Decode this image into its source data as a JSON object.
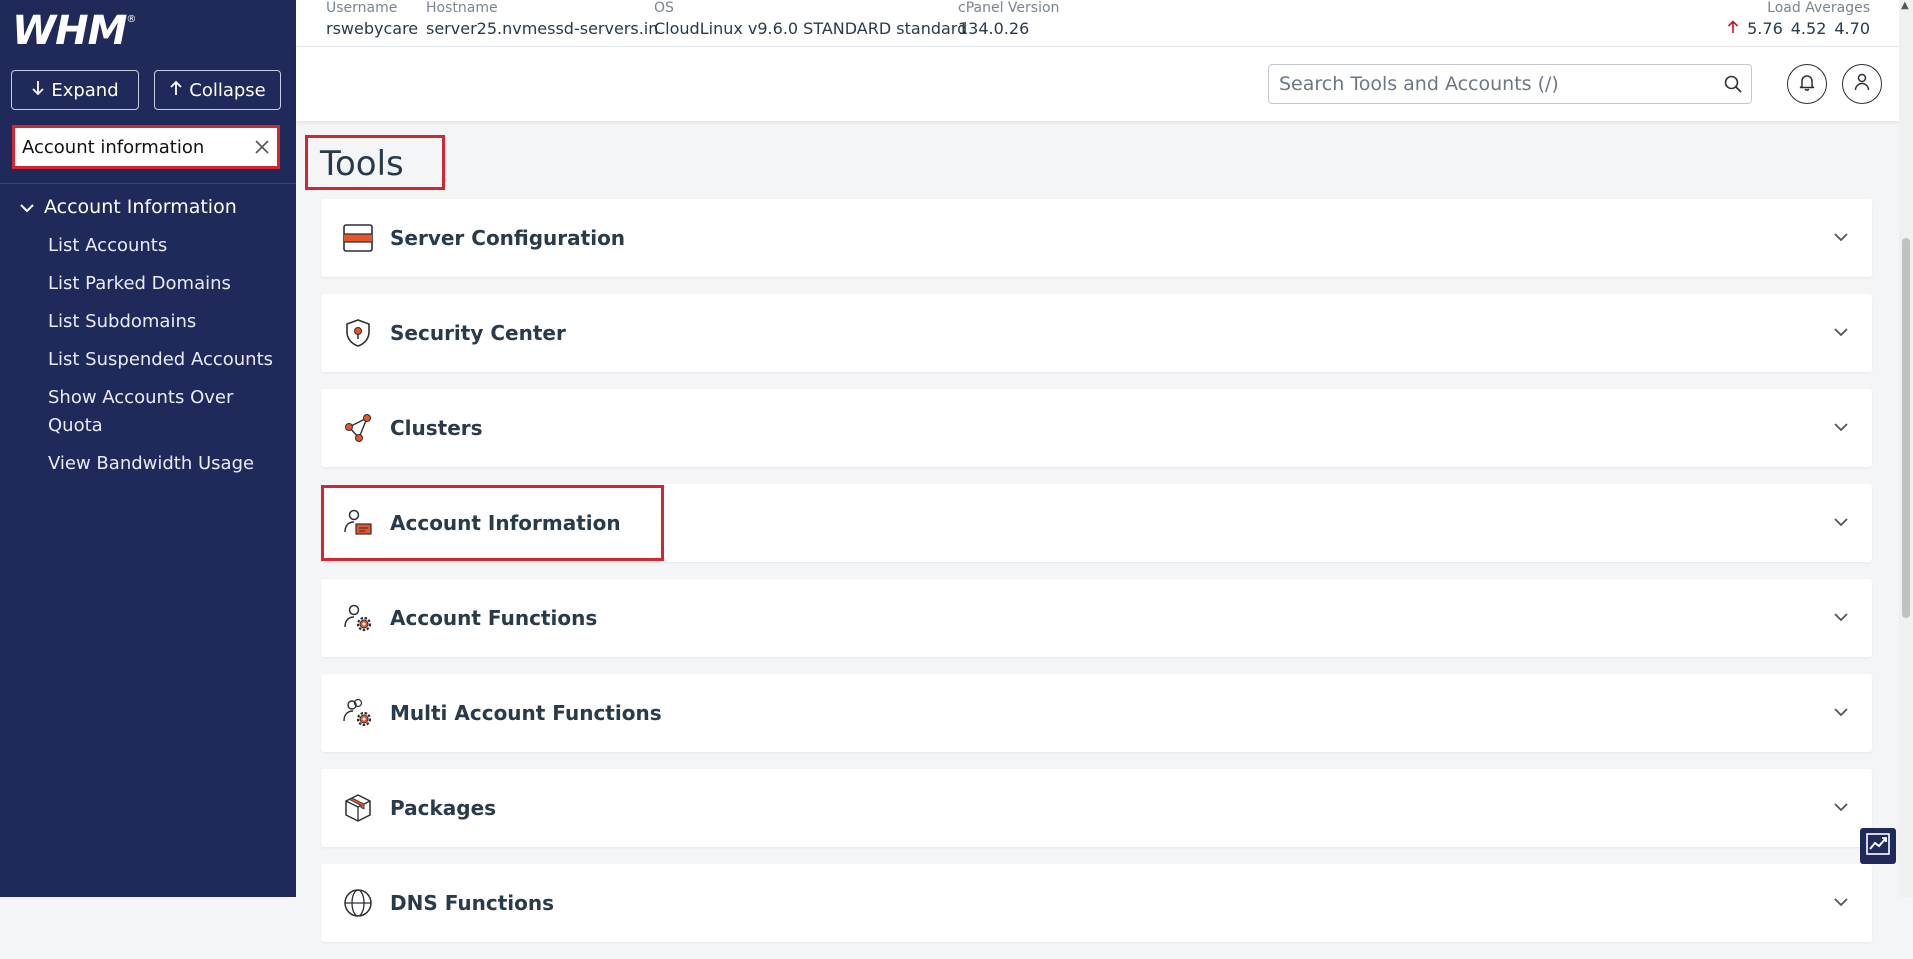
{
  "colors": {
    "sidebar_bg": "#1f2a5a",
    "accent_orange": "#e8552a",
    "highlight_red": "#d22630",
    "text_dark": "#293a4a"
  },
  "sidebar": {
    "logo": "WHM",
    "expand_label": "Expand",
    "collapse_label": "Collapse",
    "search_value": "Account information",
    "group_label": "Account Information",
    "items": [
      "List Accounts",
      "List Parked Domains",
      "List Subdomains",
      "List Suspended Accounts",
      "Show Accounts Over Quota",
      "View Bandwidth Usage"
    ]
  },
  "infobar": {
    "username_label": "Username",
    "username": "rswebycare",
    "hostname_label": "Hostname",
    "hostname": "server25.nvmessd-servers.in",
    "os_label": "OS",
    "os": "CloudLinux v9.6.0 STANDARD standard",
    "cpanel_label": "cPanel Version",
    "cpanel": "134.0.26",
    "load_label": "Load Averages",
    "load_1": "5.76",
    "load_2": "4.52",
    "load_3": "4.70"
  },
  "header": {
    "search_placeholder": "Search Tools and Accounts (/)"
  },
  "main": {
    "title": "Tools",
    "tools": [
      {
        "label": "Server Configuration",
        "icon": "server-icon"
      },
      {
        "label": "Security Center",
        "icon": "shield-icon"
      },
      {
        "label": "Clusters",
        "icon": "cluster-icon"
      },
      {
        "label": "Account Information",
        "icon": "account-info-icon"
      },
      {
        "label": "Account Functions",
        "icon": "account-gear-icon"
      },
      {
        "label": "Multi Account Functions",
        "icon": "multi-account-gear-icon"
      },
      {
        "label": "Packages",
        "icon": "package-icon"
      },
      {
        "label": "DNS Functions",
        "icon": "globe-icon"
      }
    ]
  }
}
